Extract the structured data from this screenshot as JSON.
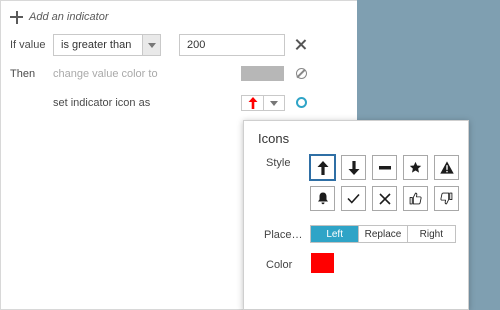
{
  "header": {
    "add_indicator_label": "Add an indicator"
  },
  "condition": {
    "if_label": "If value",
    "operator_selected": "is greater than",
    "threshold_value": "200"
  },
  "actions": {
    "then_label": "Then",
    "change_color_label": "change value color to",
    "value_color": "#b7b7b7",
    "set_icon_label": "set indicator icon as",
    "selected_icon": "arrow-up-icon",
    "selected_icon_color": "#ff0000"
  },
  "icons_popover": {
    "title": "Icons",
    "style_label": "Style",
    "icons": [
      "arrow-up-icon",
      "arrow-down-icon",
      "minus-icon",
      "star-icon",
      "warning-icon",
      "bell-icon",
      "check-icon",
      "x-icon",
      "thumbs-up-icon",
      "thumbs-down-icon"
    ],
    "selected_icon_index": 0,
    "placement_label": "Place…",
    "placement_options": [
      "Left",
      "Replace",
      "Right"
    ],
    "placement_selected": "Left",
    "color_label": "Color",
    "color_value": "#ff0000"
  },
  "colors": {
    "accent": "#2fa4c7",
    "side_panel": "#7f9fb1"
  }
}
